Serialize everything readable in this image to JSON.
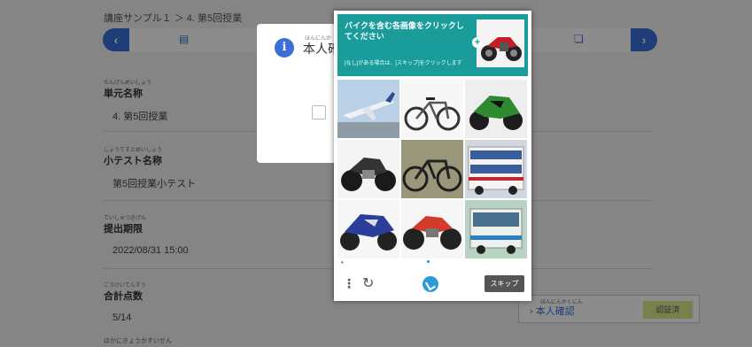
{
  "breadcrumb": "講座サンプル１ ＞ 4. 第5回授業",
  "fields": [
    {
      "ruby": "たんげんめいしょう",
      "label": "単元名称",
      "value": "4. 第5回授業"
    },
    {
      "ruby": "しょうてすとめいしょう",
      "label": "小テスト名称",
      "value": "第5回授業小テスト"
    },
    {
      "ruby": "ていしゅつきげん",
      "label": "提出期限",
      "value": "2022/08/31 15:00"
    },
    {
      "ruby": "ごうけいてんすう",
      "label": "合計点数",
      "value": "5/14"
    }
  ],
  "footer_partial": "ほかにきょうかすいせん",
  "confirm": {
    "label": "本人確認",
    "ruby": "ほんにんかくにん",
    "badge": "認証済"
  },
  "dialog": {
    "title": "本人確",
    "ruby": "ほんにんか",
    "info_icon": "i"
  },
  "captcha": {
    "title": "バイクを含む各画像をクリックしてください",
    "subtitle": "[なし]がある場合は、[スキップ]をクリックします",
    "skip_label": "スキップ",
    "tiles": [
      "airplane",
      "bicycle",
      "motorcycle",
      "motorcycle",
      "bicycle",
      "bus",
      "motorcycle",
      "motorcycle",
      "bus"
    ]
  },
  "colors": {
    "accent": "#3a6fd8",
    "captcha_header": "#1a9c9a"
  }
}
